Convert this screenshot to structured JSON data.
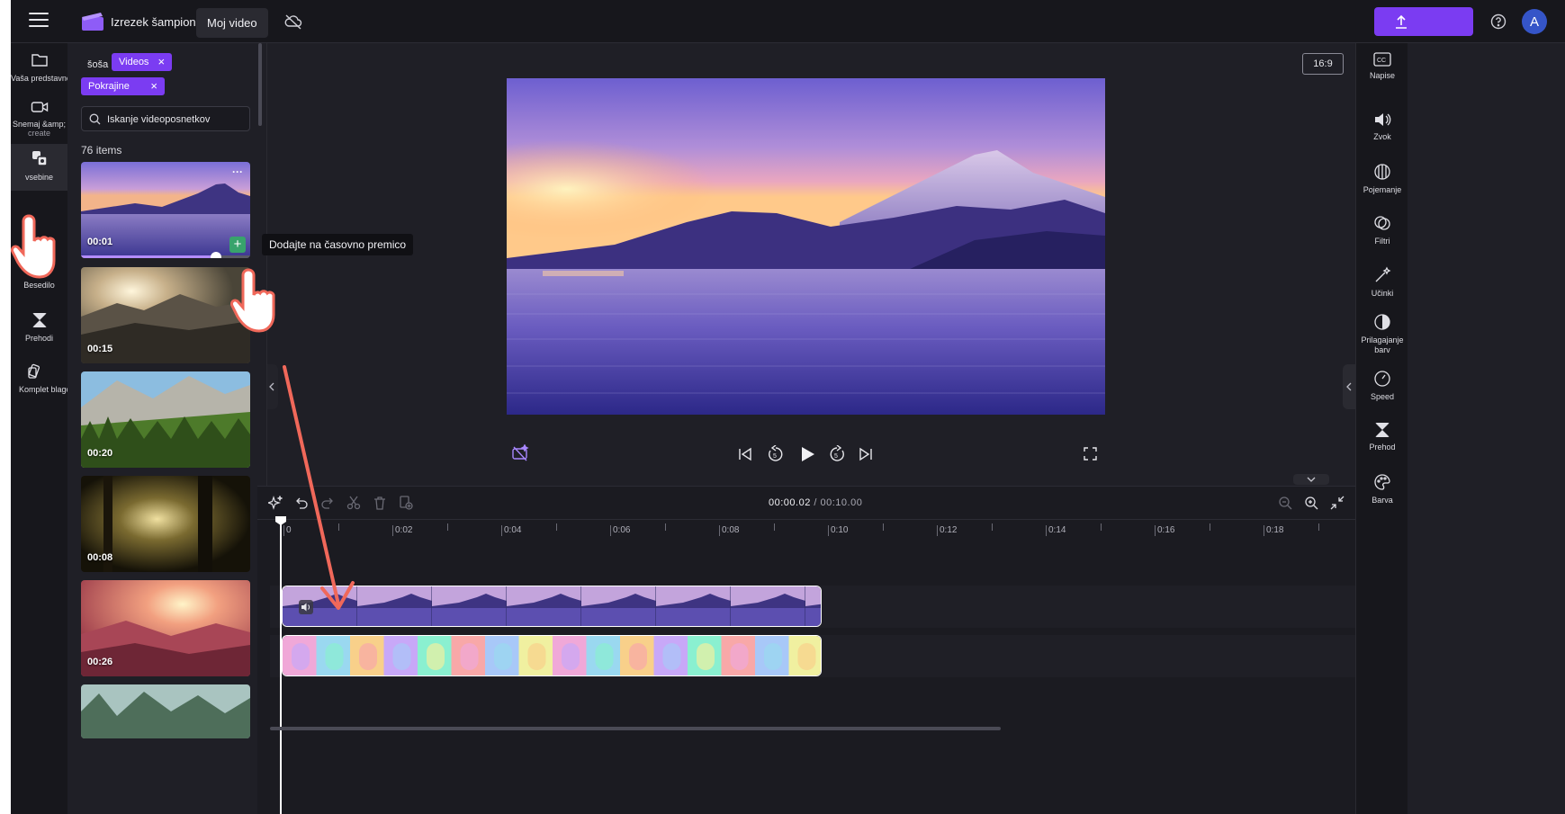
{
  "topbar": {
    "app_title": "Izrezek šampion",
    "project_name": "Moj video",
    "avatar_initial": "A"
  },
  "left_rail": {
    "items": [
      {
        "label": "Vaša predstavnost",
        "icon": "folder-icon"
      },
      {
        "label": "Snemaj &amp;",
        "sublabel": "create",
        "icon": "camera-icon"
      },
      {
        "label": "vsebine",
        "icon": "media-library-icon"
      },
      {
        "label": "Besedilo",
        "icon": "text-icon"
      },
      {
        "label": "Prehodi",
        "icon": "transitions-icon"
      },
      {
        "label": "Komplet blagovnih znamk",
        "icon": "brand-kit-icon"
      }
    ]
  },
  "panel": {
    "filter_prefix": "šoša",
    "chips": [
      "Videos",
      "Pokrajine"
    ],
    "search_placeholder": "Iskanje videoposnetkov",
    "count_number": "76",
    "count_label": "items",
    "thumbnails": [
      {
        "duration": "00:01",
        "more": "···"
      },
      {
        "duration": "00:15"
      },
      {
        "duration": "00:20"
      },
      {
        "duration": "00:08"
      },
      {
        "duration": "00:26"
      },
      {
        "duration": ""
      }
    ],
    "thumb_progress": 0.8
  },
  "tooltip": "Dodajte na časovno premico",
  "preview": {
    "aspect_ratio": "16:9"
  },
  "right_rail": {
    "items": [
      {
        "label": "Napise",
        "icon": "captions-icon"
      },
      {
        "label": "Zvok",
        "icon": "audio-icon"
      },
      {
        "label": "Pojemanje",
        "icon": "fade-icon"
      },
      {
        "label": "Filtri",
        "icon": "filters-icon"
      },
      {
        "label": "Učinki",
        "icon": "effects-icon"
      },
      {
        "label": "Prilagajanje",
        "sublabel": "barv",
        "icon": "color-adjust-icon"
      },
      {
        "label": "Speed",
        "icon": "speed-icon"
      },
      {
        "label": "Prehod",
        "icon": "transition-icon"
      },
      {
        "label": "Barva",
        "icon": "palette-icon"
      }
    ]
  },
  "timeline": {
    "current_time": "00:00.02",
    "total_time": "/ 00:10.00",
    "ruler_labels": [
      "0",
      "0:02",
      "0:04",
      "0:06",
      "0:08",
      "0:10",
      "0:12",
      "0:14",
      "0:16",
      "0:18"
    ]
  },
  "colors": {
    "accent": "#7b3cf2",
    "add_button": "#38a36c",
    "annotation": "#f0685a",
    "background": "#1f1f26"
  }
}
